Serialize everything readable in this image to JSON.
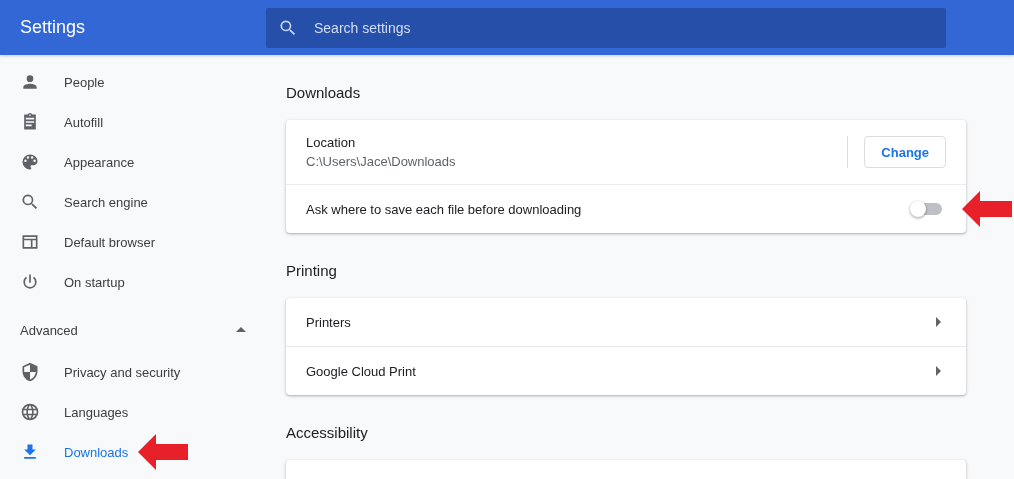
{
  "header": {
    "title": "Settings",
    "search": {
      "placeholder": "Search settings"
    }
  },
  "sidebar": {
    "items": [
      {
        "label": "People",
        "selected": false,
        "arrow": false
      },
      {
        "label": "Autofill",
        "selected": false,
        "arrow": false
      },
      {
        "label": "Appearance",
        "selected": false,
        "arrow": false
      },
      {
        "label": "Search engine",
        "selected": false,
        "arrow": false
      },
      {
        "label": "Default browser",
        "selected": false,
        "arrow": false
      },
      {
        "label": "On startup",
        "selected": false,
        "arrow": false
      }
    ],
    "advanced": {
      "label": "Advanced",
      "expanded": true,
      "items": [
        {
          "label": "Privacy and security",
          "selected": false,
          "arrow": false
        },
        {
          "label": "Languages",
          "selected": false,
          "arrow": false
        },
        {
          "label": "Downloads",
          "selected": true,
          "arrow": true
        }
      ]
    }
  },
  "sections": [
    {
      "title": "Downloads",
      "rows": [
        {
          "kind": "location",
          "label": "Location",
          "value": "C:\\Users\\Jace\\Downloads",
          "button": "Change"
        },
        {
          "kind": "toggle",
          "label": "Ask where to save each file before downloading",
          "on": false,
          "arrow": true
        }
      ]
    },
    {
      "title": "Printing",
      "rows": [
        {
          "kind": "link",
          "label": "Printers"
        },
        {
          "kind": "link",
          "label": "Google Cloud Print"
        }
      ]
    },
    {
      "title": "Accessibility"
    }
  ]
}
